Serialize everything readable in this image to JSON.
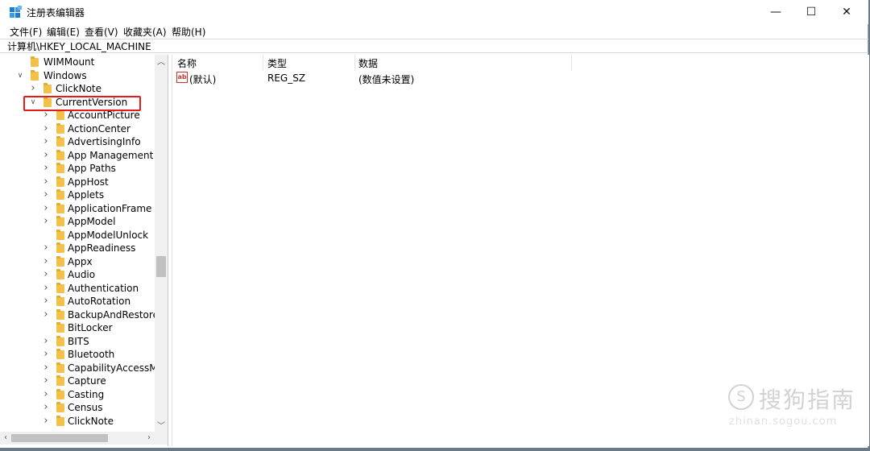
{
  "window": {
    "title": "注册表编辑器",
    "minimize": "—",
    "maximize": "☐",
    "close": "✕"
  },
  "menu": [
    "文件(F)",
    "编辑(E)",
    "查看(V)",
    "收藏夹(A)",
    "帮助(H)"
  ],
  "address": "计算机\\HKEY_LOCAL_MACHINE",
  "tree": [
    {
      "label": "WIMMount",
      "level": 0,
      "expander": "none"
    },
    {
      "label": "Windows",
      "level": 0,
      "expander": "expanded"
    },
    {
      "label": "ClickNote",
      "level": 1,
      "expander": "collapsed"
    },
    {
      "label": "CurrentVersion",
      "level": 1,
      "expander": "expanded"
    },
    {
      "label": "AccountPicture",
      "level": 2,
      "expander": "collapsed"
    },
    {
      "label": "ActionCenter",
      "level": 2,
      "expander": "collapsed"
    },
    {
      "label": "AdvertisingInfo",
      "level": 2,
      "expander": "collapsed"
    },
    {
      "label": "App Management",
      "level": 2,
      "expander": "collapsed"
    },
    {
      "label": "App Paths",
      "level": 2,
      "expander": "collapsed"
    },
    {
      "label": "AppHost",
      "level": 2,
      "expander": "collapsed"
    },
    {
      "label": "Applets",
      "level": 2,
      "expander": "collapsed"
    },
    {
      "label": "ApplicationFrame",
      "level": 2,
      "expander": "collapsed"
    },
    {
      "label": "AppModel",
      "level": 2,
      "expander": "collapsed"
    },
    {
      "label": "AppModelUnlock",
      "level": 2,
      "expander": "none"
    },
    {
      "label": "AppReadiness",
      "level": 2,
      "expander": "collapsed"
    },
    {
      "label": "Appx",
      "level": 2,
      "expander": "collapsed"
    },
    {
      "label": "Audio",
      "level": 2,
      "expander": "collapsed"
    },
    {
      "label": "Authentication",
      "level": 2,
      "expander": "collapsed"
    },
    {
      "label": "AutoRotation",
      "level": 2,
      "expander": "collapsed"
    },
    {
      "label": "BackupAndRestoreS",
      "level": 2,
      "expander": "collapsed"
    },
    {
      "label": "BitLocker",
      "level": 2,
      "expander": "none"
    },
    {
      "label": "BITS",
      "level": 2,
      "expander": "collapsed"
    },
    {
      "label": "Bluetooth",
      "level": 2,
      "expander": "collapsed"
    },
    {
      "label": "CapabilityAccessMa",
      "level": 2,
      "expander": "collapsed"
    },
    {
      "label": "Capture",
      "level": 2,
      "expander": "collapsed"
    },
    {
      "label": "Casting",
      "level": 2,
      "expander": "collapsed"
    },
    {
      "label": "Census",
      "level": 2,
      "expander": "collapsed"
    },
    {
      "label": "ClickNote",
      "level": 2,
      "expander": "collapsed"
    }
  ],
  "highlighted_key": "CurrentVersion",
  "columns": {
    "name": "名称",
    "type": "类型",
    "data": "数据"
  },
  "values": [
    {
      "name": "(默认)",
      "type": "REG_SZ",
      "data": "(数值未设置)",
      "icon": "ab"
    }
  ],
  "watermark": {
    "main": "搜狗指南",
    "sub": "zhinan.sogou.com",
    "logo": "S"
  },
  "colors": {
    "folder": "#f2c14a",
    "highlight": "#e8191c"
  }
}
